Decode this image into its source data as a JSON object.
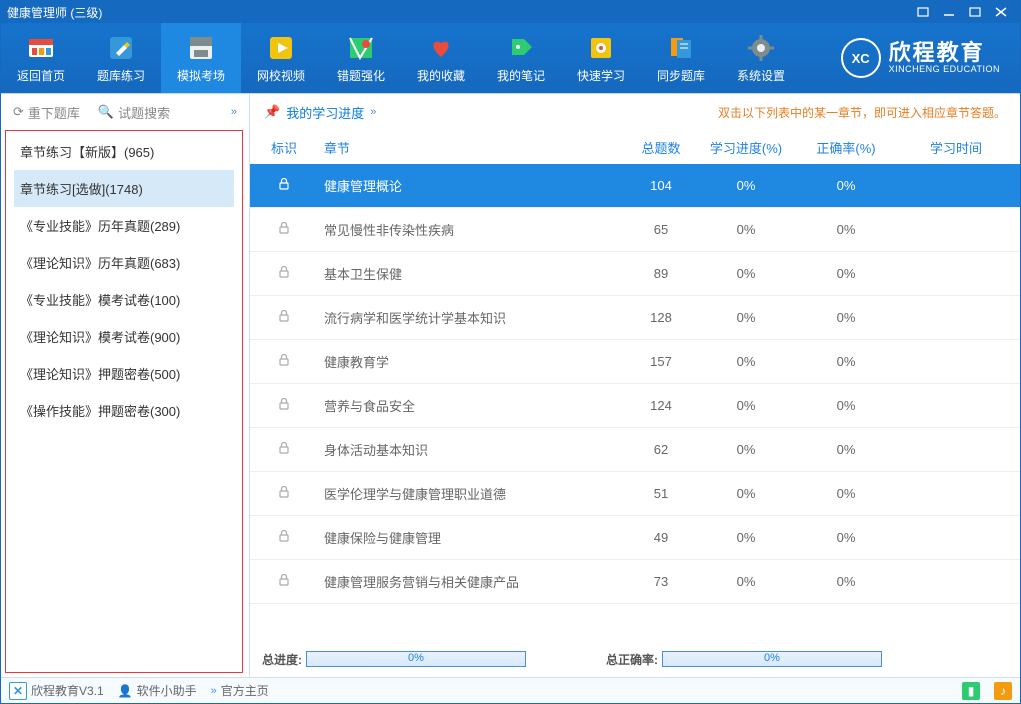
{
  "window": {
    "title": "健康管理师 (三级)"
  },
  "toolbar": {
    "items": [
      {
        "label": "返回首页"
      },
      {
        "label": "题库练习"
      },
      {
        "label": "模拟考场"
      },
      {
        "label": "网校视频"
      },
      {
        "label": "错题强化"
      },
      {
        "label": "我的收藏"
      },
      {
        "label": "我的笔记"
      },
      {
        "label": "快速学习"
      },
      {
        "label": "同步题库"
      },
      {
        "label": "系统设置"
      }
    ],
    "logo_cn": "欣程教育",
    "logo_en": "XINCHENG EDUCATION",
    "logo_badge": "XC"
  },
  "lefttools": {
    "redownload": "重下题库",
    "search": "试题搜索"
  },
  "sidebar": {
    "items": [
      {
        "label": "章节练习【新版】(965)"
      },
      {
        "label": "章节练习[选做](1748)"
      },
      {
        "label": "《专业技能》历年真题(289)"
      },
      {
        "label": "《理论知识》历年真题(683)"
      },
      {
        "label": "《专业技能》模考试卷(100)"
      },
      {
        "label": "《理论知识》模考试卷(900)"
      },
      {
        "label": "《理论知识》押题密卷(500)"
      },
      {
        "label": "《操作技能》押题密卷(300)"
      }
    ]
  },
  "rightbar": {
    "progress_label": "我的学习进度",
    "tip": "双击以下列表中的某一章节，即可进入相应章节答题。"
  },
  "columns": {
    "mark": "标识",
    "chapter": "章节",
    "total": "总题数",
    "progress": "学习进度(%)",
    "accuracy": "正确率(%)",
    "time": "学习时间"
  },
  "rows": [
    {
      "chapter": "健康管理概论",
      "total": "104",
      "progress": "0%",
      "accuracy": "0%"
    },
    {
      "chapter": "常见慢性非传染性疾病",
      "total": "65",
      "progress": "0%",
      "accuracy": "0%"
    },
    {
      "chapter": "基本卫生保健",
      "total": "89",
      "progress": "0%",
      "accuracy": "0%"
    },
    {
      "chapter": "流行病学和医学统计学基本知识",
      "total": "128",
      "progress": "0%",
      "accuracy": "0%"
    },
    {
      "chapter": "健康教育学",
      "total": "157",
      "progress": "0%",
      "accuracy": "0%"
    },
    {
      "chapter": "营养与食品安全",
      "total": "124",
      "progress": "0%",
      "accuracy": "0%"
    },
    {
      "chapter": "身体活动基本知识",
      "total": "62",
      "progress": "0%",
      "accuracy": "0%"
    },
    {
      "chapter": "医学伦理学与健康管理职业道德",
      "total": "51",
      "progress": "0%",
      "accuracy": "0%"
    },
    {
      "chapter": "健康保险与健康管理",
      "total": "49",
      "progress": "0%",
      "accuracy": "0%"
    },
    {
      "chapter": "健康管理服务营销与相关健康产品",
      "total": "73",
      "progress": "0%",
      "accuracy": "0%"
    }
  ],
  "totals": {
    "progress_label": "总进度:",
    "progress_value": "0%",
    "accuracy_label": "总正确率:",
    "accuracy_value": "0%"
  },
  "status": {
    "brand": "欣程教育V3.1",
    "helper": "软件小助手",
    "home": "官方主页"
  }
}
